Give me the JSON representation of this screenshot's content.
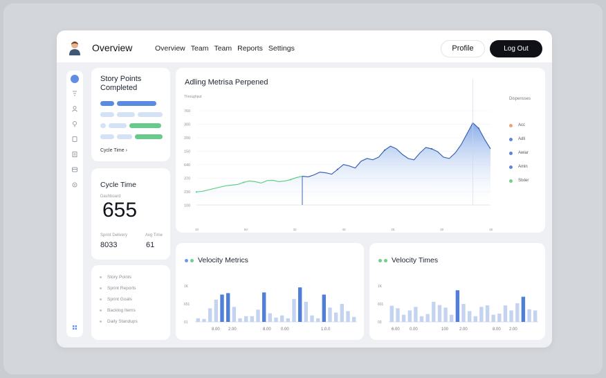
{
  "header": {
    "title": "Overview",
    "nav": [
      "Overview",
      "Team",
      "Team",
      "Reports",
      "Settings"
    ],
    "profile_label": "Profile",
    "logout_label": "Log Out"
  },
  "sidebar": {
    "icons": [
      "home-icon",
      "filter-icon",
      "users-icon",
      "pin-icon",
      "clipboard-icon",
      "document-icon",
      "archive-icon",
      "settings-icon",
      "grid-icon"
    ]
  },
  "story_card": {
    "title": "Story Points Completed",
    "footer": "Cycle Time"
  },
  "cycle_card": {
    "title": "Cycle Time",
    "sub": "Dashboard",
    "value": "655",
    "label1": "Sprint Delivery",
    "label2": "Avg Time",
    "value1": "8033",
    "value2": "61"
  },
  "list_card": {
    "items": [
      "Story Points",
      "Sprint Reports",
      "Sprint Goals",
      "Backlog Items",
      "Daily Standups"
    ]
  },
  "main_chart": {
    "title": "Adling Metrisa Perpened",
    "legend_title": "Dispensses",
    "legend": [
      {
        "label": "Acc",
        "color": "#f0a07a"
      },
      {
        "label": "Adli",
        "color": "#5b86d6"
      },
      {
        "label": "Awiar",
        "color": "#5b86d6"
      },
      {
        "label": "Amin",
        "color": "#5b86d6"
      },
      {
        "label": "Stxler",
        "color": "#6fd08a"
      }
    ],
    "colors": {
      "line": "#3d63b5",
      "green": "#5fcf86",
      "fill": "#7aa3e6"
    }
  },
  "velocity": {
    "title": "Velocity Metrics",
    "dots": [
      "#6a9ae6",
      "#6fd08a"
    ]
  },
  "times": {
    "title": "Velocity Times",
    "dots": [
      "#6fd08a",
      "#6fd08a"
    ]
  },
  "chart_data": [
    {
      "type": "area",
      "title": "Adling Metrisa Perpened",
      "ylabel": "Throughput",
      "y_ticks": [
        "760",
        "300",
        "200",
        "150",
        "640",
        "370",
        "230",
        "100"
      ],
      "x_ticks": [
        "10",
        "50",
        "32",
        "40",
        "25",
        "30",
        "18"
      ],
      "ylim": [
        0,
        800
      ],
      "x": [
        0,
        1,
        2,
        3,
        4,
        5,
        6,
        7,
        8,
        9,
        10,
        11,
        12,
        13,
        14,
        15,
        16,
        17,
        18,
        19,
        20,
        21,
        22,
        23,
        24,
        25,
        26,
        27,
        28,
        29,
        30,
        31,
        32,
        33,
        34,
        35,
        36,
        37,
        38,
        39,
        40,
        41,
        42,
        43,
        44,
        45,
        46,
        47,
        48,
        49,
        50
      ],
      "series": [
        {
          "values": [
            95,
            100,
            110,
            120,
            130,
            140,
            145,
            150,
            165,
            175,
            170,
            160,
            178,
            180,
            170,
            175,
            185,
            200,
            210,
            205,
            220,
            240,
            235,
            225,
            260,
            295,
            285,
            270,
            320,
            340,
            330,
            350,
            400,
            430,
            410,
            370,
            340,
            330,
            380,
            420,
            410,
            390,
            350,
            340,
            380,
            440,
            520,
            600,
            560,
            480,
            410
          ]
        }
      ]
    },
    {
      "type": "bar",
      "title": "Velocity Metrics",
      "y_ticks": [
        "1K",
        "651",
        "01"
      ],
      "x_ticks": [
        "8.00",
        "2.00",
        "8.00",
        "0.00",
        "1.0.0"
      ],
      "ylim": [
        0,
        1000
      ],
      "values": [
        100,
        80,
        380,
        620,
        760,
        800,
        420,
        100,
        160,
        160,
        340,
        820,
        240,
        120,
        180,
        100,
        640,
        960,
        560,
        180,
        100,
        760,
        400,
        260,
        500,
        300,
        140
      ]
    },
    {
      "type": "bar",
      "title": "Velocity Times",
      "y_ticks": [
        "1K",
        "601",
        "03"
      ],
      "x_ticks": [
        "6.00",
        "0.00",
        "100",
        "2.00",
        "8.00",
        "2.00"
      ],
      "ylim": [
        0,
        1000
      ],
      "values": [
        450,
        380,
        200,
        320,
        420,
        160,
        220,
        560,
        470,
        400,
        200,
        880,
        500,
        300,
        160,
        420,
        460,
        200,
        230,
        460,
        320,
        520,
        700,
        350,
        320
      ]
    }
  ]
}
